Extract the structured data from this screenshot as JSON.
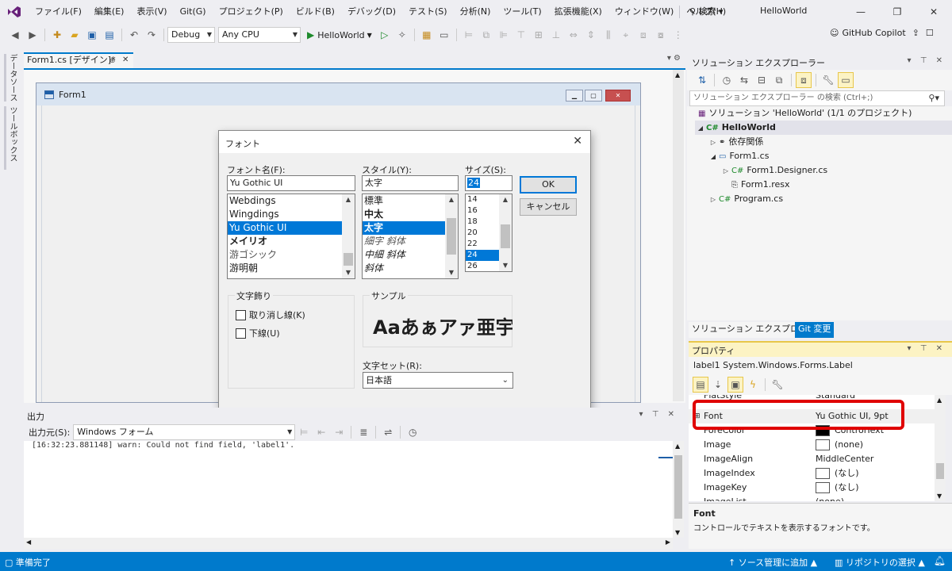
{
  "menubar": {
    "items": [
      "ファイル(F)",
      "編集(E)",
      "表示(V)",
      "Git(G)",
      "プロジェクト(P)",
      "ビルド(B)",
      "デバッグ(D)",
      "テスト(S)",
      "分析(N)",
      "ツール(T)",
      "拡張機能(X)",
      "ウィンドウ(W)",
      "ヘルプ(H)"
    ],
    "search": "検索",
    "solution_title": "HelloWorld"
  },
  "toolbar": {
    "config": "Debug",
    "platform": "Any CPU",
    "run_label": "HelloWorld",
    "copilot": "GitHub Copilot"
  },
  "lefttabs": {
    "datasource": "データソース",
    "toolbox": "ツールボックス"
  },
  "doctab": {
    "label": "Form1.cs [デザイン]*"
  },
  "form1": {
    "title": "Form1"
  },
  "font_dialog": {
    "title": "フォント",
    "font_name_label": "フォント名(F):",
    "font_name_value": "Yu Gothic UI",
    "font_list": [
      "Webdings",
      "Wingdings",
      "Yu Gothic UI",
      "メイリオ",
      "游ゴシック",
      "游明朝"
    ],
    "style_label": "スタイル(Y):",
    "style_value": "太字",
    "style_list": [
      "標準",
      "中太",
      "太字",
      "細字 斜体",
      "中細 斜体",
      "斜体"
    ],
    "size_label": "サイズ(S):",
    "size_value": "24",
    "size_list": [
      "14",
      "16",
      "18",
      "20",
      "22",
      "24",
      "26"
    ],
    "ok": "OK",
    "cancel": "キャンセル",
    "effects_group": "文字飾り",
    "strikeout": "取り消し線(K)",
    "underline": "下線(U)",
    "sample_group": "サンプル",
    "sample_text": "Aaあぁアァ亜宇",
    "charset_label": "文字セット(R):",
    "charset_value": "日本語"
  },
  "output": {
    "title": "出力",
    "source_label": "出力元(S):",
    "source_value": "Windows フォーム",
    "log_line": "[16:32:23.881148] warn: Could not find field, 'label1'."
  },
  "solution_explorer": {
    "title": "ソリューション エクスプローラー",
    "search_placeholder": "ソリューション エクスプローラー の検索 (Ctrl+;)",
    "tree": [
      {
        "label": "ソリューション 'HelloWorld' (1/1 のプロジェクト)"
      },
      {
        "label": "HelloWorld"
      },
      {
        "label": "依存関係"
      },
      {
        "label": "Form1.cs"
      },
      {
        "label": "Form1.Designer.cs"
      },
      {
        "label": "Form1.resx"
      },
      {
        "label": "Program.cs"
      }
    ],
    "tab_se": "ソリューション エクスプローラー",
    "tab_git": "Git 変更"
  },
  "properties": {
    "title": "プロパティ",
    "object": "label1  System.Windows.Forms.Label",
    "rows": [
      {
        "name": "FlatStyle",
        "value": "Standard"
      },
      {
        "name": "Font",
        "value": "Yu Gothic UI, 9pt"
      },
      {
        "name": "ForeColor",
        "value": "ControlText"
      },
      {
        "name": "Image",
        "value": "(none)"
      },
      {
        "name": "ImageAlign",
        "value": "MiddleCenter"
      },
      {
        "name": "ImageIndex",
        "value": "(なし)"
      },
      {
        "name": "ImageKey",
        "value": "(なし)"
      },
      {
        "name": "ImageList",
        "value": "(none)"
      }
    ],
    "desc_title": "Font",
    "desc_text": "コントロールでテキストを表示するフォントです。"
  },
  "status": {
    "left": "準備完了",
    "add_scm": "ソース管理に追加",
    "repo": "リポジトリの選択"
  },
  "colors": {
    "accent": "#007acc",
    "selection": "#0078d7",
    "highlight_box": "#e00000"
  }
}
